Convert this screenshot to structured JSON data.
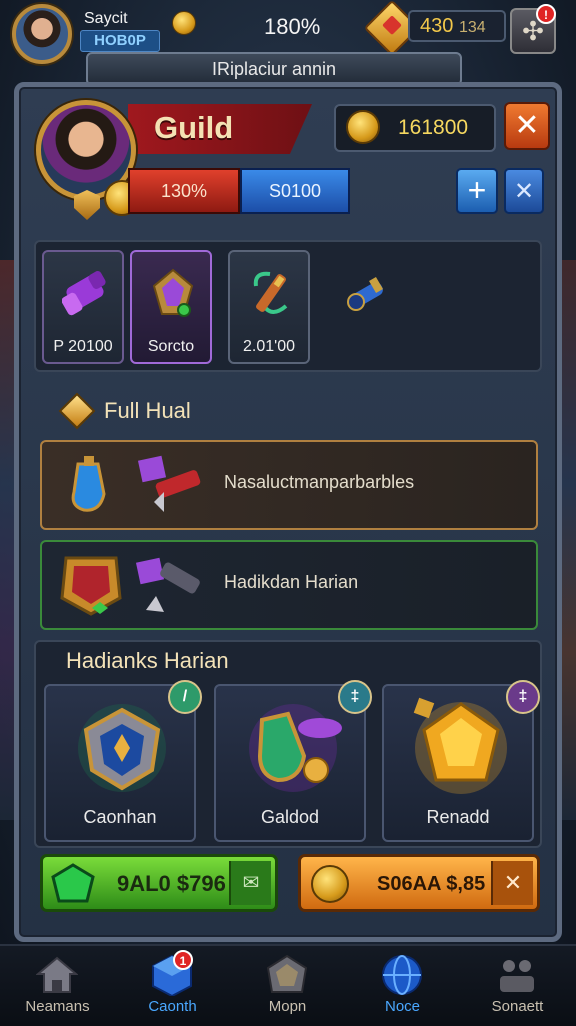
{
  "top_bar": {
    "player_name": "Saycit",
    "player_id": "HOB0P",
    "percent": "180%",
    "gold": "430",
    "gold_suffix": "134",
    "notification_count": "!"
  },
  "title_banner": "IRiplaciur annin",
  "guild": {
    "title": "Guild",
    "bar_red": "130%",
    "bar_blue": "S0100",
    "currency_value": "161800",
    "close_label": "✕",
    "plus_label": "+",
    "swords_label": "✕"
  },
  "items": [
    {
      "label": "P 20100",
      "icon": "purple-scroll-icon"
    },
    {
      "label": "Sorcto",
      "icon": "amethyst-amulet-icon"
    },
    {
      "label": "2.01'00",
      "icon": "enchanted-dagger-icon"
    },
    {
      "label": "",
      "icon": "blue-cannon-icon"
    }
  ],
  "full_hui": {
    "title": "Full Hual",
    "rows": [
      {
        "text": "Nasaluctmanparbarbles"
      },
      {
        "text": "Hadikdan Harian"
      }
    ]
  },
  "rewards": {
    "title": "Hadianks Harian",
    "cards": [
      {
        "label": "Caonhan",
        "badge": "/",
        "badge_color": "#2e9a6a",
        "icon": "sapphire-shield-icon"
      },
      {
        "label": "Galdod",
        "badge": "‡",
        "badge_color": "#2a7a8a",
        "icon": "emerald-potion-icon"
      },
      {
        "label": "Renadd",
        "badge": "‡",
        "badge_color": "#6a3a8a",
        "icon": "gold-gem-icon"
      }
    ]
  },
  "buy_buttons": {
    "green_text": "9AL0 $796",
    "orange_text": "S06AA $,85",
    "orange_close": "✕"
  },
  "bottom_nav": [
    {
      "label": "Neamans",
      "icon": "home-icon",
      "active": false
    },
    {
      "label": "Caonth",
      "icon": "cube-icon",
      "active": true,
      "badge": "1"
    },
    {
      "label": "Mopn",
      "icon": "chest-icon",
      "active": false
    },
    {
      "label": "Noce",
      "icon": "globe-icon",
      "active": true
    },
    {
      "label": "Sonaett",
      "icon": "social-icon",
      "active": false
    }
  ],
  "colors": {
    "accent_red": "#a0181e",
    "accent_blue": "#1c4ea8",
    "gold": "#f6d860",
    "panel_bg": "#243144"
  }
}
